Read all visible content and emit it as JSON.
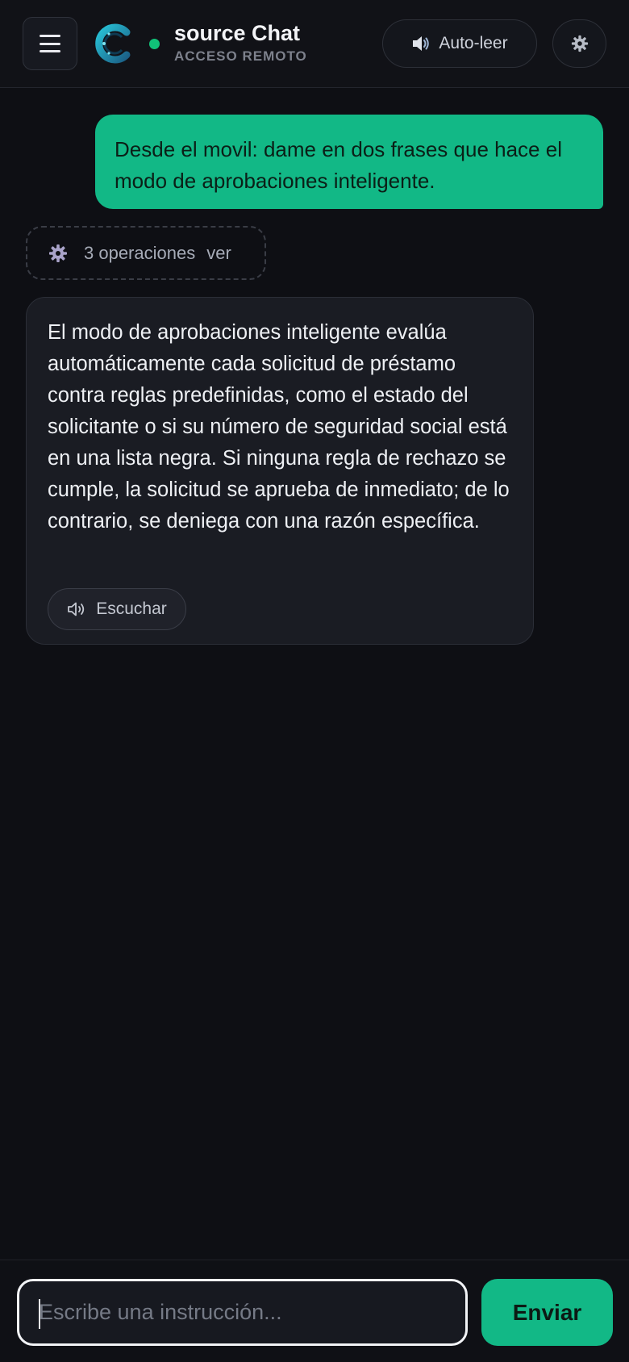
{
  "header": {
    "menu_icon": "hamburger-icon",
    "logo_icon": "source-logo-c",
    "status": "online",
    "status_color": "#11c178",
    "title": "source Chat",
    "subtitle": "ACCESO REMOTO",
    "autoread_icon": "speaker-icon",
    "autoread_label": "Auto-leer",
    "settings_icon": "gear-icon"
  },
  "messages": [
    {
      "role": "user",
      "text": "Desde el movil: dame en dos frases que hace el modo de aprobaciones inteligente."
    },
    {
      "role": "operations",
      "icon": "gear-icon",
      "label": "3 operaciones",
      "action": "ver"
    },
    {
      "role": "assistant",
      "text": "El modo de aprobaciones inteligente evalúa automáticamente cada solicitud de préstamo contra reglas predefinidas, como el estado del solicitante o si su número de seguridad social está en una lista negra. Si ninguna regla de rechazo se cumple, la solicitud se aprueba de inmediato; de lo contrario, se deniega con una razón específica.",
      "listen_icon": "speaker-outline-icon",
      "listen_label": "Escuchar"
    }
  ],
  "composer": {
    "placeholder": "Escribe una instrucción...",
    "value": "",
    "send_label": "Enviar"
  },
  "colors": {
    "accent": "#12b886",
    "background": "#0e0f14",
    "bubble_assistant": "#1a1c23"
  }
}
